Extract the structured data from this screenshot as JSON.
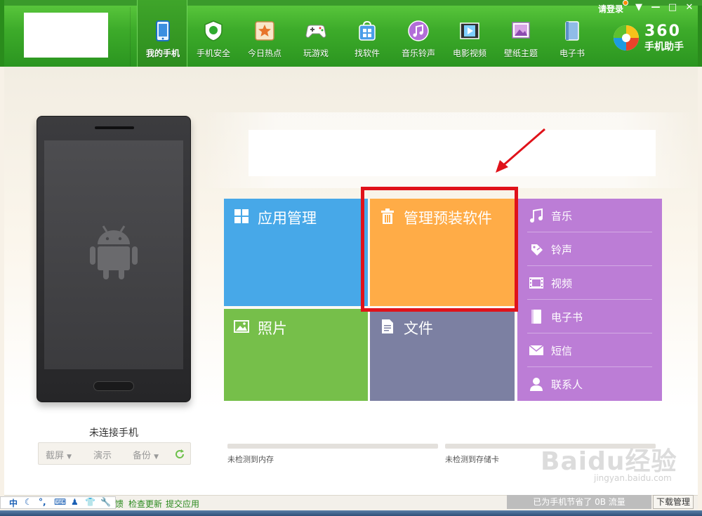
{
  "header": {
    "login": "请登录",
    "window_controls": [
      "▼",
      "—",
      "□",
      "✕"
    ],
    "brand": {
      "number": "360",
      "name": "手机助手"
    },
    "nav": [
      {
        "label": "我的手机",
        "icon": "phone-icon",
        "active": true
      },
      {
        "label": "手机安全",
        "icon": "shield-icon",
        "active": false
      },
      {
        "label": "今日热点",
        "icon": "star-icon",
        "active": false
      },
      {
        "label": "玩游戏",
        "icon": "gamepad-icon",
        "active": false
      },
      {
        "label": "找软件",
        "icon": "app-bag-icon",
        "active": false
      },
      {
        "label": "音乐铃声",
        "icon": "music-note-icon",
        "active": false
      },
      {
        "label": "电影视频",
        "icon": "film-icon",
        "active": false
      },
      {
        "label": "壁纸主题",
        "icon": "wallpaper-icon",
        "active": false
      },
      {
        "label": "电子书",
        "icon": "book-icon",
        "active": false
      }
    ]
  },
  "phone": {
    "status": "未连接手机",
    "actions": {
      "screenshot": "截屏",
      "demo": "演示",
      "backup": "备份"
    }
  },
  "tiles": {
    "apps": "应用管理",
    "preinstall": "管理预装软件",
    "photos": "照片",
    "files": "文件"
  },
  "media": [
    {
      "label": "音乐",
      "icon": "music-icon"
    },
    {
      "label": "铃声",
      "icon": "ringtone-icon"
    },
    {
      "label": "视频",
      "icon": "video-icon"
    },
    {
      "label": "电子书",
      "icon": "ebook-icon"
    },
    {
      "label": "短信",
      "icon": "sms-icon"
    },
    {
      "label": "联系人",
      "icon": "contact-icon"
    }
  ],
  "storage": {
    "memory": "未检测到内存",
    "sdcard": "未检测到存储卡"
  },
  "statusbar": {
    "feedback": "馈",
    "check_update": "检查更新",
    "submit_app": "提交应用",
    "traffic": "已为手机节省了 0B 流量",
    "download_manager": "下载管理"
  },
  "ime": [
    "中",
    "☾",
    "°,",
    "⌨",
    "♟",
    "👕",
    "🔧"
  ],
  "watermark": {
    "main": "Baidu经验",
    "sub": "jingyan.baidu.com"
  }
}
